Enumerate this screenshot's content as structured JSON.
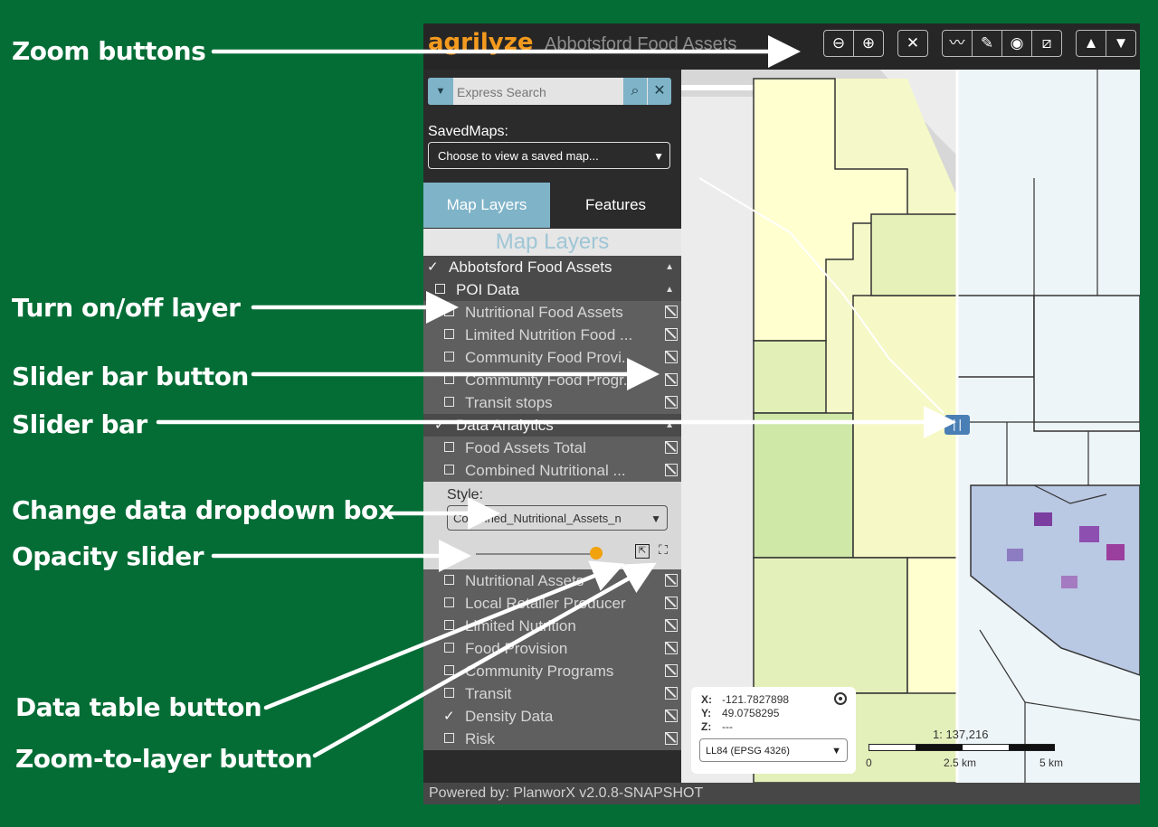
{
  "callouts": {
    "zoom_buttons": "Zoom buttons",
    "turn_on_off": "Turn on/off layer",
    "slider_bar_button": "Slider bar button",
    "slider_bar": "Slider bar",
    "change_data": "Change data dropdown box",
    "opacity": "Opacity slider",
    "data_table": "Data table button",
    "zoom_to_layer": "Zoom-to-layer button"
  },
  "app": {
    "logo": "agrilyze",
    "title": "Abbotsford Food Assets",
    "search_placeholder": "Express Search",
    "saved_maps_label": "SavedMaps:",
    "saved_maps_value": "Choose to view a saved map...",
    "tabs": [
      "Map Layers",
      "Features"
    ],
    "panel_heading": "Map Layers",
    "footer": "Powered by: PlanworX v2.0.8-SNAPSHOT"
  },
  "layers_top": [
    {
      "label": "Abbotsford Food Assets",
      "state": "checked",
      "indent": 0,
      "group": true
    },
    {
      "label": "POI Data",
      "state": "unchecked",
      "indent": 1,
      "group": true
    },
    {
      "label": "Nutritional Food Assets",
      "state": "unchecked",
      "indent": 2
    },
    {
      "label": "Limited Nutrition Food ...",
      "state": "unchecked",
      "indent": 2
    },
    {
      "label": "Community Food Provi...",
      "state": "unchecked",
      "indent": 2
    },
    {
      "label": "Community Food Progr...",
      "state": "unchecked",
      "indent": 2
    },
    {
      "label": "Transit stops",
      "state": "unchecked",
      "indent": 2
    },
    {
      "label": "Data Analytics",
      "state": "checked",
      "indent": 1,
      "group": true
    },
    {
      "label": "Food Assets Total",
      "state": "unchecked",
      "indent": 2
    },
    {
      "label": "Combined Nutritional ...",
      "state": "unchecked",
      "indent": 2
    }
  ],
  "style_box": {
    "label": "Style:",
    "selected": "Combined_Nutritional_Assets_n",
    "opacity": 0.95
  },
  "layers_bottom": [
    {
      "label": "Nutritional Assets",
      "state": "unchecked",
      "indent": 2
    },
    {
      "label": "Local Retailer Producer",
      "state": "unchecked",
      "indent": 2
    },
    {
      "label": "Limited Nutrition",
      "state": "unchecked",
      "indent": 2
    },
    {
      "label": "Food Provision",
      "state": "unchecked",
      "indent": 2
    },
    {
      "label": "Community Programs",
      "state": "unchecked",
      "indent": 2
    },
    {
      "label": "Transit",
      "state": "unchecked",
      "indent": 2
    },
    {
      "label": "Density Data",
      "state": "checked",
      "indent": 2
    },
    {
      "label": "Risk",
      "state": "unchecked",
      "indent": 2
    }
  ],
  "coords": {
    "x_label": "X:",
    "x": "-121.7827898",
    "y_label": "Y:",
    "y": "49.0758295",
    "z_label": "Z:",
    "z": "---",
    "projection": "LL84 (EPSG 4326)"
  },
  "scale": {
    "ratio": "1: 137,216",
    "ticks": [
      "0",
      "2.5 km",
      "5 km"
    ]
  },
  "colors": {
    "background": "#036d35",
    "accent": "#7fb3c8",
    "opacity_knob": "#f2a20c"
  }
}
